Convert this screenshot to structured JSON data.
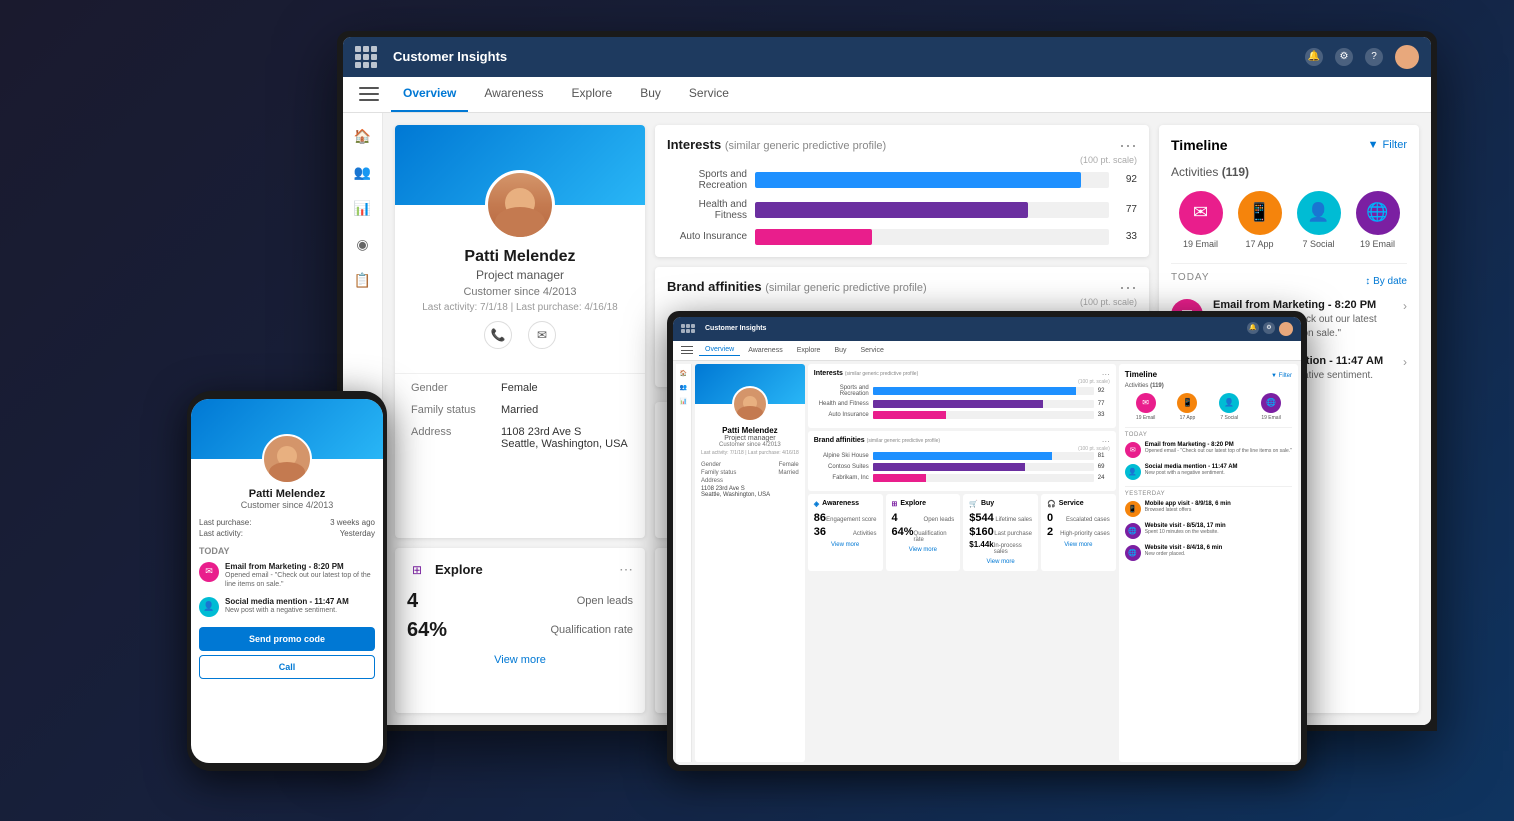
{
  "app": {
    "title": "Customer Insights",
    "nav_tabs": [
      "Overview",
      "Awareness",
      "Explore",
      "Buy",
      "Service"
    ],
    "active_tab": "Overview"
  },
  "profile": {
    "name": "Patti Melendez",
    "role": "Project manager",
    "customer_since": "Customer since 4/2013",
    "last_activity": "Last activity: 7/1/18",
    "last_purchase": "Last purchase: 4/16/18",
    "gender_label": "Gender",
    "gender_value": "Female",
    "family_label": "Family status",
    "family_value": "Married",
    "address_label": "Address",
    "address_line1": "1108 23rd Ave S",
    "address_line2": "Seattle, Washington, USA"
  },
  "interests": {
    "title": "Interests",
    "subtitle": "(similar generic predictive profile)",
    "scale_note": "(100 pt. scale)",
    "bars": [
      {
        "label": "Sports and Recreation",
        "value": 92,
        "pct": 92,
        "color": "#1e90ff"
      },
      {
        "label": "Health and Fitness",
        "value": 77,
        "pct": 77,
        "color": "#6b2fa0"
      },
      {
        "label": "Auto Insurance",
        "value": 33,
        "pct": 33,
        "color": "#e91e8c"
      }
    ]
  },
  "brand_affinities": {
    "title": "Brand affinities",
    "subtitle": "(similar generic predictive profile)",
    "scale_note": "(100 pt. scale)",
    "bars": [
      {
        "label": "Alpine Ski House",
        "value": 81,
        "pct": 81,
        "color": "#1e90ff"
      },
      {
        "label": "Contoso Suites",
        "value": 69,
        "pct": 69,
        "color": "#6b2fa0"
      },
      {
        "label": "Fabrikam, Inc",
        "value": 24,
        "pct": 24,
        "color": "#e91e8c"
      }
    ]
  },
  "timeline": {
    "title": "Timeline",
    "filter_label": "Filter",
    "activities_label": "Activities",
    "activities_count": "(119)",
    "sort_label": "By date",
    "today_label": "TODAY",
    "activity_icons": [
      {
        "label": "19 Email",
        "color": "#e91e8c",
        "icon": "✉"
      },
      {
        "label": "17 App",
        "color": "#f5840c",
        "icon": "📱"
      },
      {
        "label": "7 Social",
        "color": "#00bcd4",
        "icon": "👤"
      },
      {
        "label": "19 Email",
        "color": "#7b1fa2",
        "icon": "🌐"
      }
    ],
    "items": [
      {
        "title": "Email from Marketing - 8:20 PM",
        "desc": "Opened email - \"Check out our latest top of the line items on sale.\"",
        "color": "#e91e8c",
        "icon": "✉"
      },
      {
        "title": "Social media mention - 11:47 AM",
        "desc": "New post with a negative sentiment.",
        "color": "#00bcd4",
        "icon": "👤"
      }
    ]
  },
  "awareness_card": {
    "title": "Awareness",
    "icon": "◈",
    "icon_color": "#0078d4",
    "metrics": [
      {
        "value": "86",
        "label": "Engagement score"
      },
      {
        "value": "36",
        "label": "Activities"
      }
    ],
    "view_more": "View more"
  },
  "explore_card": {
    "title": "Explore",
    "icon": "⊞",
    "icon_color": "#7b1fa2",
    "metrics": [
      {
        "value": "4",
        "label": "Open leads"
      },
      {
        "value": "64%",
        "label": "Qualification rate"
      }
    ],
    "view_more": "View more"
  },
  "buy_card": {
    "title": "Buy",
    "icon": "🛒",
    "icon_color": "#f57c00",
    "metrics": [
      {
        "value": "$544",
        "label": "Lifetime sales"
      },
      {
        "value": "$160",
        "label": "Last purchase"
      },
      {
        "value": "$1.44k",
        "label": "In-process sales"
      }
    ],
    "view_more": "View more"
  },
  "phone": {
    "name": "Patti Melendez",
    "role": "Customer since 4/2013",
    "last_purchase_label": "Last purchase:",
    "last_purchase_value": "3 weeks ago",
    "last_activity_label": "Last activity:",
    "last_activity_value": "Yesterday",
    "today_label": "TODAY",
    "timeline_items": [
      {
        "title": "Email from Marketing - 8:20 PM",
        "desc": "Opened email - \"Check out our latest top of the line items on sale.\"",
        "color": "#e91e8c",
        "icon": "✉"
      },
      {
        "title": "Social media mention - 11:47 AM",
        "desc": "New post with a negative sentiment.",
        "color": "#00bcd4",
        "icon": "👤"
      }
    ],
    "send_promo_label": "Send promo code",
    "call_label": "Call"
  }
}
